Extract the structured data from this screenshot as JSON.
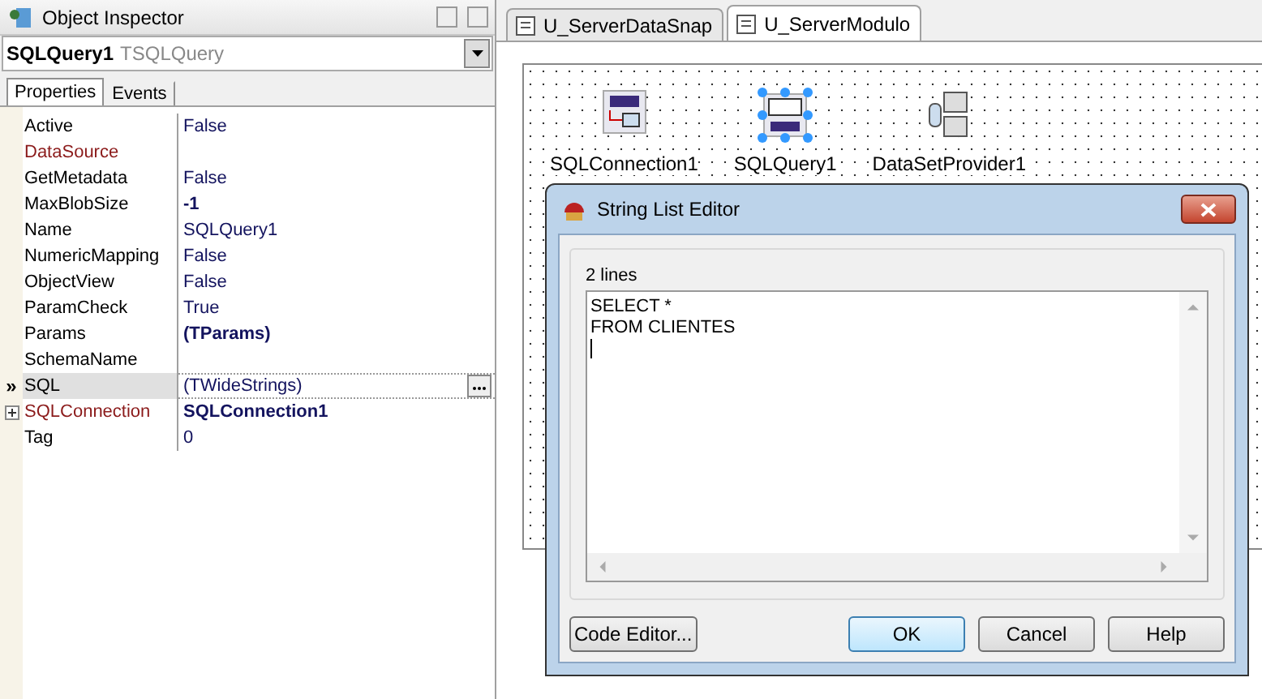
{
  "inspector": {
    "title": "Object Inspector",
    "object_name": "SQLQuery1",
    "object_type": "TSQLQuery",
    "row_marker": "»",
    "tabs": [
      {
        "label": "Properties",
        "selected": true
      },
      {
        "label": "Events",
        "selected": false
      }
    ],
    "properties": [
      {
        "name": "Active",
        "value": "False",
        "kind": "plain",
        "value_bold": false,
        "selected": false,
        "expandable": false
      },
      {
        "name": "DataSource",
        "kind": "reference",
        "selected": false,
        "expandable": false
      },
      {
        "name": "GetMetadata",
        "value": "False",
        "kind": "plain",
        "value_bold": false,
        "selected": false,
        "expandable": false
      },
      {
        "name": "MaxBlobSize",
        "value": "-1",
        "kind": "plain",
        "value_bold": true,
        "selected": false,
        "expandable": false
      },
      {
        "name": "Name",
        "value": "SQLQuery1",
        "kind": "plain",
        "value_bold": false,
        "selected": false,
        "expandable": false
      },
      {
        "name": "NumericMapping",
        "value": "False",
        "kind": "plain",
        "value_bold": false,
        "selected": false,
        "expandable": false
      },
      {
        "name": "ObjectView",
        "value": "False",
        "kind": "plain",
        "value_bold": false,
        "selected": false,
        "expandable": false
      },
      {
        "name": "ParamCheck",
        "value": "True",
        "kind": "plain",
        "value_bold": false,
        "selected": false,
        "expandable": false
      },
      {
        "name": "Params",
        "value": "(TParams)",
        "kind": "plain",
        "value_bold": true,
        "selected": false,
        "expandable": false
      },
      {
        "name": "SchemaName",
        "kind": "plain",
        "selected": false,
        "expandable": false
      },
      {
        "name": "SQL",
        "value": "(TWideStrings)",
        "kind": "plain",
        "value_bold": false,
        "selected": true,
        "expandable": false
      },
      {
        "name": "SQLConnection",
        "value": "SQLConnection1",
        "kind": "reference",
        "value_bold": true,
        "selected": false,
        "expandable": true
      },
      {
        "name": "Tag",
        "value": "0",
        "kind": "plain",
        "value_bold": false,
        "selected": false,
        "expandable": false
      }
    ]
  },
  "editor_tabs": [
    {
      "label": "U_ServerDataSnap",
      "selected": false
    },
    {
      "label": "U_ServerModulo",
      "selected": true
    }
  ],
  "components": [
    {
      "label": "SQLConnection1",
      "kind": "connection",
      "selected": false
    },
    {
      "label": "SQLQuery1",
      "kind": "query",
      "selected": true
    },
    {
      "label": "DataSetProvider1",
      "kind": "provider",
      "selected": false
    }
  ],
  "dialog": {
    "title": "String List Editor",
    "line_count": "2 lines",
    "lines": [
      "SELECT *",
      "FROM CLIENTES"
    ],
    "buttons": [
      {
        "label": "Code Editor...",
        "default": false
      },
      {
        "label": "OK",
        "default": true
      },
      {
        "label": "Cancel",
        "default": false
      },
      {
        "label": "Help",
        "default": false
      }
    ]
  }
}
